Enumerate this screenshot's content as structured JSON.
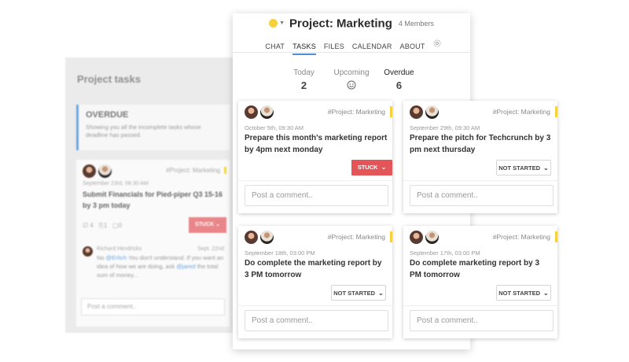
{
  "background_panel": {
    "title": "Project tasks",
    "overdue_box": {
      "title": "OVERDUE",
      "description": "Showing you all the incomplete tasks whose deadline has passed."
    },
    "card": {
      "tag": "#Project: Marketing",
      "date": "September 23rd, 06:30 AM",
      "title": "Submit Financials for Pied-piper Q3 15-16 by 3 pm today",
      "counts": {
        "subtasks": "4",
        "attachments": "1",
        "comments": "0"
      },
      "status": "STUCK",
      "comment": {
        "author": "Richard Hendricks",
        "time": "Sept. 22nd",
        "prefix": "No ",
        "mention1": "@Erlich",
        "middle": " You don't understand. If you want an idea of how we are doing, ask ",
        "mention2": "@jared",
        "suffix": " the total sum of money..."
      },
      "comment_placeholder": "Post a comment.."
    }
  },
  "header": {
    "project_title": "Project: Marketing",
    "members": "4 Members",
    "tabs": [
      {
        "label": "CHAT",
        "active": false
      },
      {
        "label": "TASKS",
        "active": true
      },
      {
        "label": "FILES",
        "active": false
      },
      {
        "label": "CALENDAR",
        "active": false
      },
      {
        "label": "ABOUT",
        "active": false
      }
    ],
    "settings_icon": "gear-icon"
  },
  "stats": {
    "today": {
      "label": "Today",
      "value": "2"
    },
    "upcoming": {
      "label": "Upcoming",
      "icon": "smiley-icon"
    },
    "overdue": {
      "label": "Overdue",
      "value": "6"
    }
  },
  "cards": [
    {
      "tag": "#Project: Marketing",
      "date": "October 5th, 09:30 AM",
      "title": "Prepare this month's marketing report by 4pm next monday",
      "status": "STUCK",
      "placeholder": "Post a comment.."
    },
    {
      "tag": "#Project: Marketing",
      "date": "September 29th, 09:30 AM",
      "title": "Prepare the pitch for Techcrunch by 3 pm next thursday",
      "status": "NOT STARTED",
      "placeholder": "Post a comment.."
    },
    {
      "tag": "#Project: Marketing",
      "date": "September 18th, 03:00 PM",
      "title": "Do complete the marketing report by 3 PM tomorrow",
      "status": "NOT STARTED",
      "placeholder": "Post a comment.."
    },
    {
      "tag": "#Project: Marketing",
      "date": "September 17th, 03:00 PM",
      "title": "Do complete marketing report by 3 PM tomorrow",
      "status": "NOT STARTED",
      "placeholder": "Post a comment.."
    }
  ],
  "colors": {
    "accent": "#4a90d9",
    "stuck": "#e4555a",
    "project_dot": "#f5d23c",
    "overdue_border": "#6aa6e0"
  }
}
